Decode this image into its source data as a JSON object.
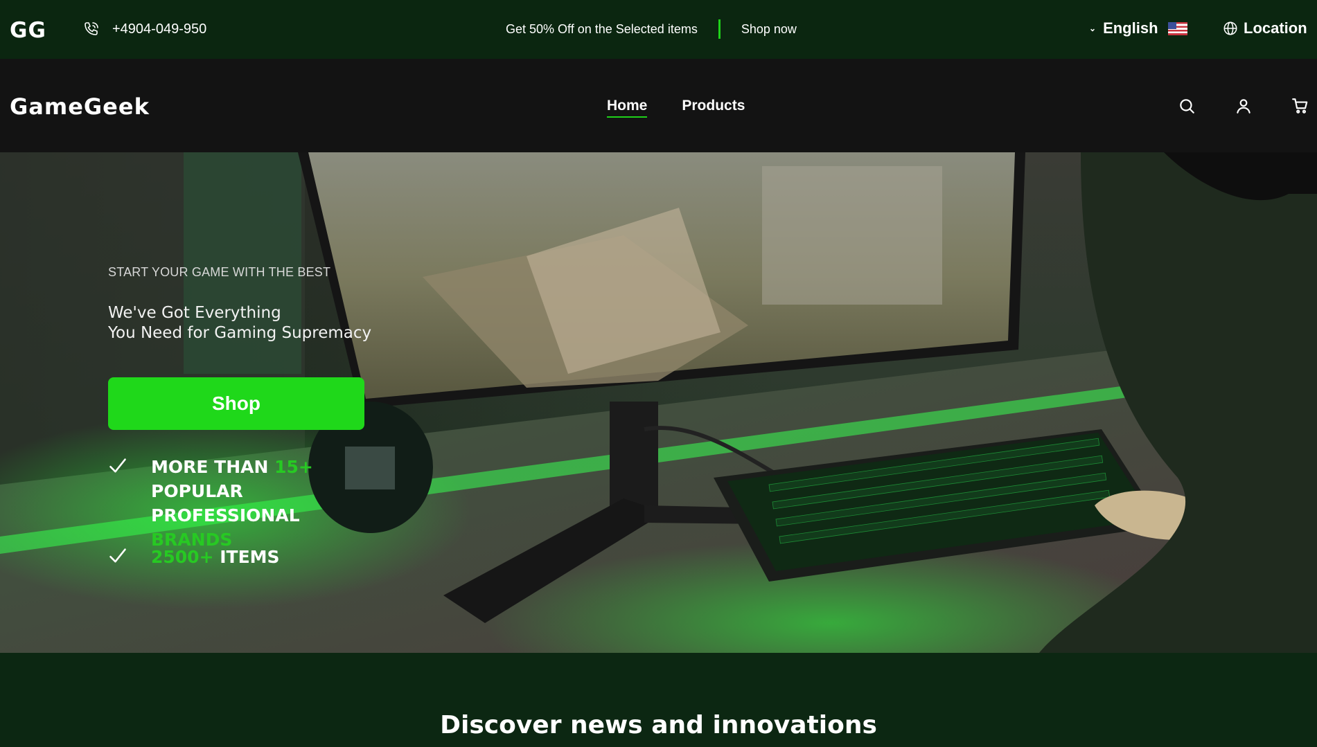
{
  "topbar": {
    "logo": "GG",
    "phone": "+4904-049-950",
    "promo_text": "Get 50% Off on the Selected items",
    "promo_link": "Shop now",
    "language": "English",
    "location": "Location",
    "bg_color": "#0b2610"
  },
  "navbar": {
    "brand": "GameGeek",
    "menu": [
      {
        "label": "Home",
        "active": true
      },
      {
        "label": "Products",
        "active": false
      }
    ],
    "icons": [
      "search-icon",
      "user-icon",
      "cart-icon"
    ]
  },
  "hero": {
    "kicker": "START YOUR GAME WITH THE BEST",
    "headline_line1": "We've Got Everything",
    "headline_line2": "You Need for Gaming Supremacy",
    "cta": "Shop",
    "features": [
      {
        "prefix": "MORE THAN ",
        "highlight": "15+",
        "middle": " POPULAR PROFESSIONAL ",
        "suffix_highlight": "BRANDS"
      },
      {
        "highlight": "2500+",
        "suffix": " ITEMS"
      }
    ],
    "accent_color": "#1fd81a"
  },
  "section": {
    "title": "Discover news and innovations"
  }
}
